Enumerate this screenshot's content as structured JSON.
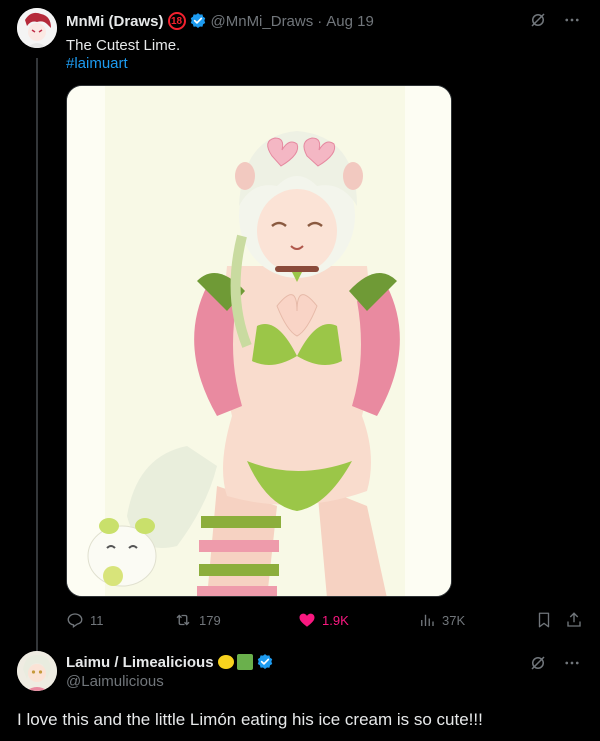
{
  "post": {
    "author_name": "MnMi (Draws)",
    "badge_label": "18",
    "handle": "@MnMi_Draws",
    "separator": "·",
    "date": "Aug 19",
    "text": "The Cutest Lime.",
    "hashtag": "#laimuart",
    "image_alt": "anime illustration of a white-haired girl with lime accents making a heart with her hands",
    "stats": {
      "replies": "11",
      "reposts": "179",
      "likes": "1.9K",
      "views": "37K"
    }
  },
  "reply": {
    "author_name": "Laimu / Limealicious",
    "handle": "@Laimulicious",
    "text": "I love this and the little Limón eating his ice cream is so cute!!!"
  },
  "colors": {
    "background": "#000000",
    "text": "#e7e9ea",
    "muted": "#71767b",
    "link": "#1d9bf0",
    "like": "#f91880",
    "verified": "#1d9bf0",
    "badge": "#f4212e"
  }
}
